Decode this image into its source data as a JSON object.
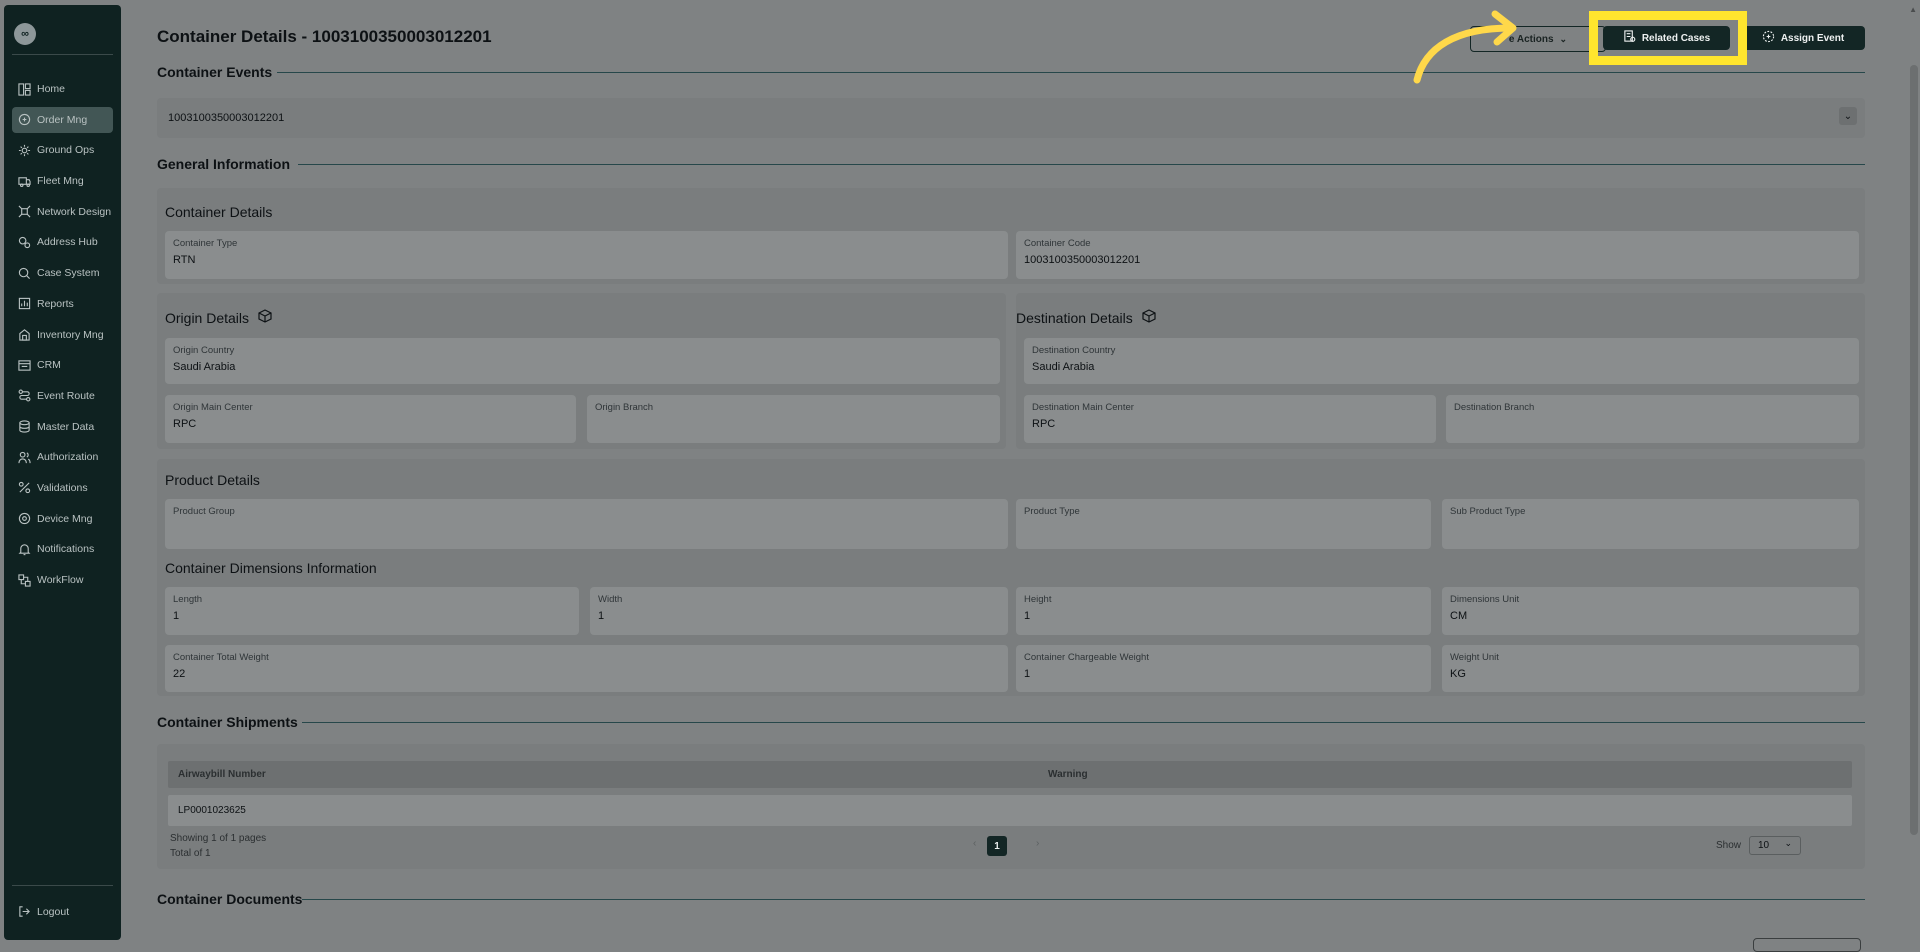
{
  "sidebar": {
    "logo": "∞",
    "items": [
      {
        "label": "Home",
        "icon": "layout-icon",
        "active": false
      },
      {
        "label": "Order Mng",
        "icon": "order-icon",
        "active": true
      },
      {
        "label": "Ground Ops",
        "icon": "ground-ops-icon",
        "active": false
      },
      {
        "label": "Fleet Mng",
        "icon": "truck-icon",
        "active": false
      },
      {
        "label": "Network Design",
        "icon": "network-icon",
        "active": false
      },
      {
        "label": "Address Hub",
        "icon": "address-icon",
        "active": false
      },
      {
        "label": "Case System",
        "icon": "case-icon",
        "active": false
      },
      {
        "label": "Reports",
        "icon": "reports-icon",
        "active": false
      },
      {
        "label": "Inventory Mng",
        "icon": "inventory-icon",
        "active": false
      },
      {
        "label": "CRM",
        "icon": "crm-icon",
        "active": false
      },
      {
        "label": "Event Route",
        "icon": "route-icon",
        "active": false
      },
      {
        "label": "Master Data",
        "icon": "database-icon",
        "active": false
      },
      {
        "label": "Authorization",
        "icon": "users-icon",
        "active": false
      },
      {
        "label": "Validations",
        "icon": "percent-icon",
        "active": false
      },
      {
        "label": "Device Mng",
        "icon": "device-icon",
        "active": false
      },
      {
        "label": "Notifications",
        "icon": "bell-icon",
        "active": false
      },
      {
        "label": "WorkFlow",
        "icon": "workflow-icon",
        "active": false
      }
    ],
    "logout": "Logout"
  },
  "header": {
    "title": "Container Details - 1003100350003012201",
    "more_actions": "e Actions",
    "related_cases": "Related Cases",
    "assign_event": "Assign Event"
  },
  "events": {
    "section_title": "Container Events",
    "selected": "1003100350003012201"
  },
  "general": {
    "section_title": "General Information",
    "container_details": {
      "title": "Container Details",
      "container_type_label": "Container Type",
      "container_type": "RTN",
      "container_code_label": "Container Code",
      "container_code": "1003100350003012201"
    },
    "origin": {
      "title": "Origin Details",
      "country_label": "Origin Country",
      "country": "Saudi Arabia",
      "main_center_label": "Origin Main Center",
      "main_center": "RPC",
      "branch_label": "Origin Branch",
      "branch": ""
    },
    "destination": {
      "title": "Destination Details",
      "country_label": "Destination Country",
      "country": "Saudi Arabia",
      "main_center_label": "Destination Main Center",
      "main_center": "RPC",
      "branch_label": "Destination Branch",
      "branch": ""
    },
    "product": {
      "title": "Product Details",
      "group_label": "Product Group",
      "type_label": "Product Type",
      "sub_type_label": "Sub Product Type"
    },
    "dimensions": {
      "title": "Container Dimensions Information",
      "length_label": "Length",
      "length": "1",
      "width_label": "Width",
      "width": "1",
      "height_label": "Height",
      "height": "1",
      "unit_label": "Dimensions Unit",
      "unit": "CM",
      "total_weight_label": "Container Total Weight",
      "total_weight": "22",
      "chargeable_weight_label": "Container Chargeable Weight",
      "chargeable_weight": "1",
      "weight_unit_label": "Weight Unit",
      "weight_unit": "KG"
    }
  },
  "shipments": {
    "section_title": "Container Shipments",
    "columns": [
      "Airwaybill Number",
      "Warning"
    ],
    "rows": [
      [
        "LP0001023625",
        ""
      ]
    ],
    "showing": "Showing 1 of 1 pages",
    "total": "Total of 1",
    "page": "1",
    "show_label": "Show",
    "page_size": "10"
  },
  "documents": {
    "section_title": "Container Documents"
  },
  "colors": {
    "sidebar": "#0f2221",
    "accent": "#132625",
    "highlight": "#ffe52e",
    "arrow": "#ffd84a"
  }
}
